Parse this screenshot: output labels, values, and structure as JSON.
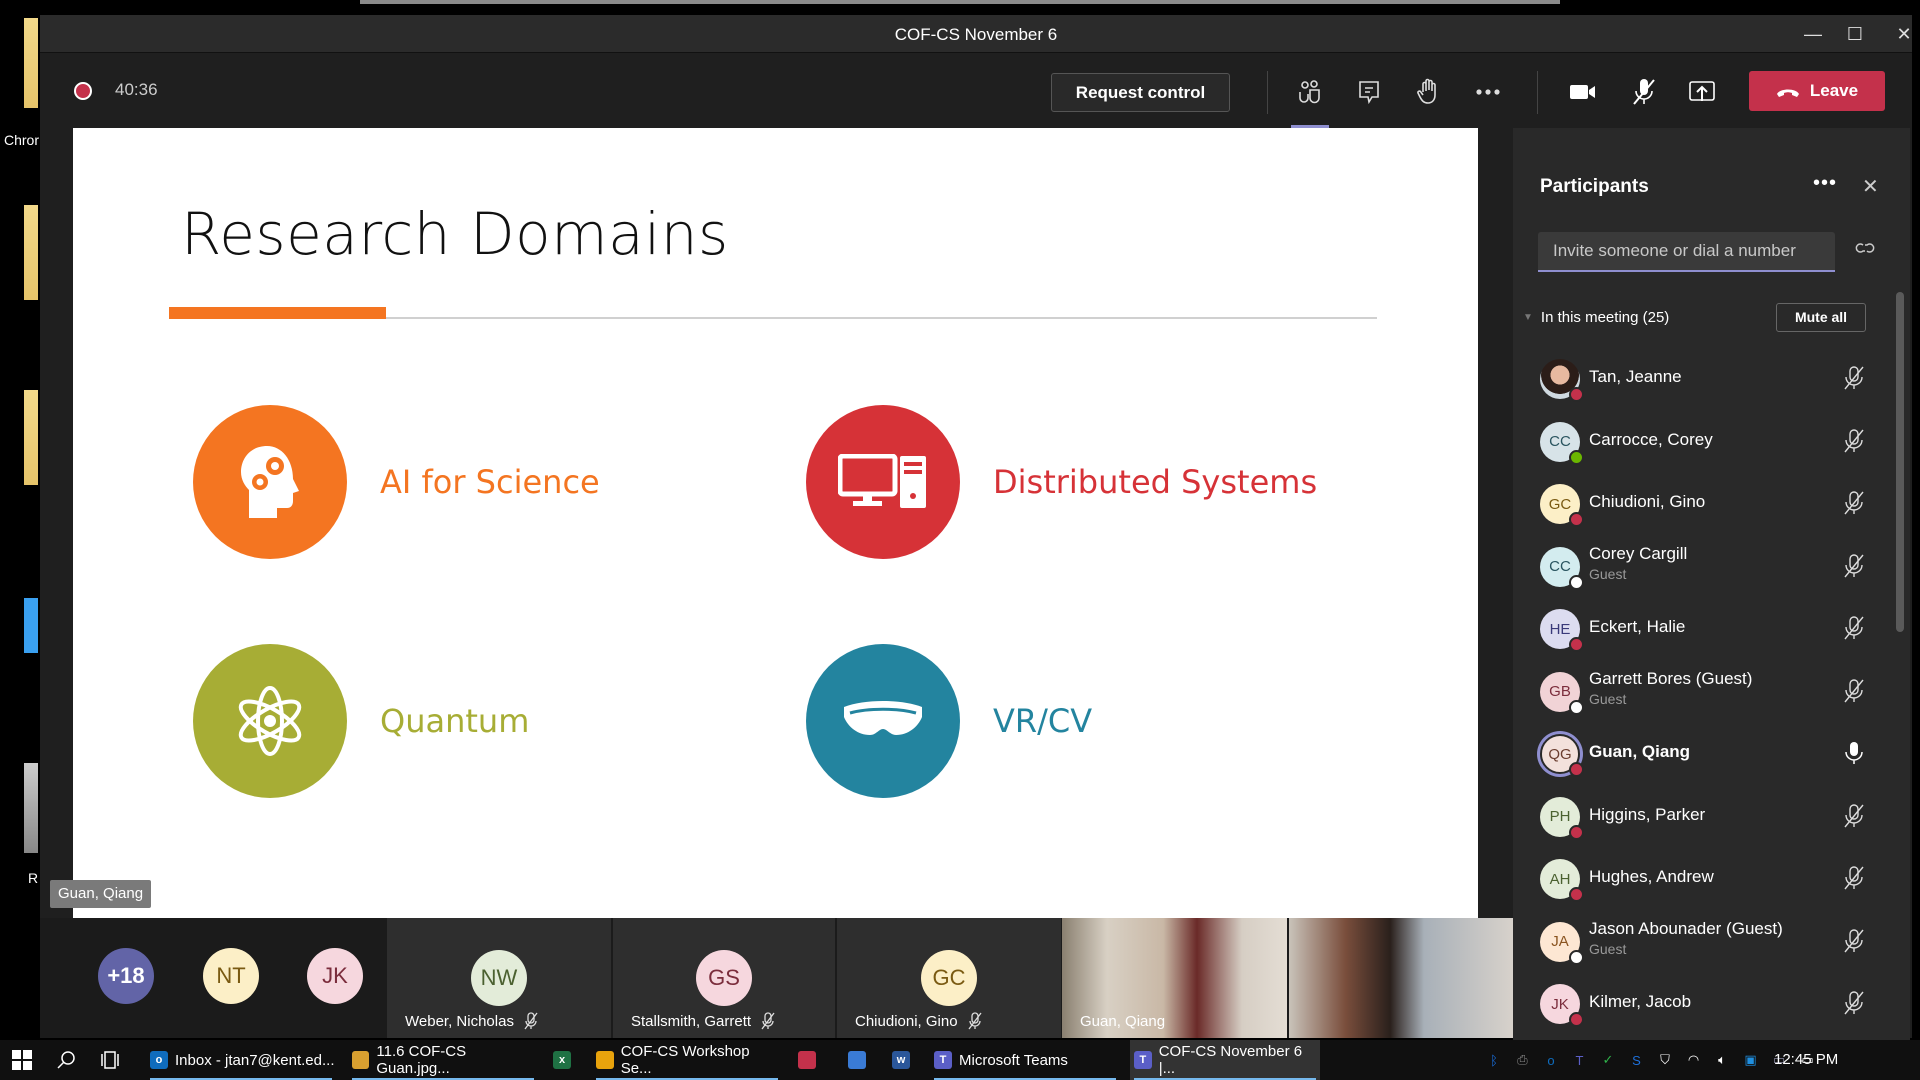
{
  "window": {
    "title": "COF-CS November 6",
    "minimize_label": "—",
    "maximize_label": "☐",
    "close_label": "✕"
  },
  "toolbar": {
    "timer": "40:36",
    "request_control": "Request control",
    "leave": "Leave",
    "icons": [
      "participants-icon",
      "chat-icon",
      "raise-hand-icon",
      "more-options-icon",
      "camera-icon",
      "mic-off-icon",
      "share-screen-icon"
    ]
  },
  "slide": {
    "title": "Research Domains",
    "accent_color": "#f47521",
    "domains": [
      {
        "label": "AI for Science",
        "color": "#f47521",
        "icon": "head-gears-icon"
      },
      {
        "label": "Distributed Systems",
        "color": "#d63237",
        "icon": "computer-icon"
      },
      {
        "label": "Quantum",
        "color": "#a7ad35",
        "icon": "atom-icon"
      },
      {
        "label": "VR/CV",
        "color": "#23849f",
        "icon": "vr-headset-icon"
      }
    ]
  },
  "presenter_tag": "Guan, Qiang",
  "desktop": {
    "labels": [
      "Chror",
      "R"
    ]
  },
  "video_strip": {
    "overflow": {
      "label": "+18",
      "bg": "#6264a7",
      "fg": "#ffffff"
    },
    "avatars": [
      {
        "initials": "NT",
        "bg": "#fcefc7",
        "fg": "#7a5a12"
      },
      {
        "initials": "JK",
        "bg": "#f6d7de",
        "fg": "#7b2d3c"
      }
    ],
    "tiles": [
      {
        "name": "Weber, Nicholas",
        "initials": "NW",
        "bg": "#e3ecd9",
        "fg": "#4b6130",
        "muted": true
      },
      {
        "name": "Stallsmith, Garrett",
        "initials": "GS",
        "bg": "#f6d7de",
        "fg": "#7b2d3c",
        "muted": true
      },
      {
        "name": "Chiudioni, Gino",
        "initials": "GC",
        "bg": "#fcefc7",
        "fg": "#7a5a12",
        "muted": true
      }
    ],
    "videos": [
      {
        "name": "Guan, Qiang"
      },
      {
        "name": ""
      }
    ]
  },
  "participants": {
    "title": "Participants",
    "more_label": "•••",
    "close_label": "✕",
    "invite_placeholder": "Invite someone or dial a number",
    "section_label": "In this meeting (25)",
    "mute_all": "Mute all",
    "people": [
      {
        "name": "Tan, Jeanne",
        "sub": "",
        "initials": "",
        "photo": true,
        "bg": "#cfd9e0",
        "fg": "#333",
        "status": "busy",
        "mic": "muted",
        "bold": false
      },
      {
        "name": "Carrocce, Corey",
        "sub": "",
        "initials": "CC",
        "photo": false,
        "bg": "#d7e3e8",
        "fg": "#2a5560",
        "status": "available",
        "mic": "muted",
        "bold": false
      },
      {
        "name": "Chiudioni, Gino",
        "sub": "",
        "initials": "GC",
        "photo": false,
        "bg": "#fcefc7",
        "fg": "#7a5a12",
        "status": "busy",
        "mic": "muted",
        "bold": false
      },
      {
        "name": "Corey Cargill",
        "sub": "Guest",
        "initials": "CC",
        "photo": false,
        "bg": "#d3ecef",
        "fg": "#2a5560",
        "status": "unknown",
        "mic": "muted",
        "bold": false
      },
      {
        "name": "Eckert, Halie",
        "sub": "",
        "initials": "HE",
        "photo": false,
        "bg": "#dcdcf0",
        "fg": "#3a3a7a",
        "status": "busy",
        "mic": "muted",
        "bold": false
      },
      {
        "name": "Garrett Bores (Guest)",
        "sub": "Guest",
        "initials": "GB",
        "photo": false,
        "bg": "#f1d3d6",
        "fg": "#7b2d3c",
        "status": "unknown",
        "mic": "muted",
        "bold": false
      },
      {
        "name": "Guan, Qiang",
        "sub": "",
        "initials": "QG",
        "photo": false,
        "bg": "#f3e1dc",
        "fg": "#6b3e30",
        "status": "dnd",
        "mic": "on",
        "bold": true,
        "active": true
      },
      {
        "name": "Higgins, Parker",
        "sub": "",
        "initials": "PH",
        "photo": false,
        "bg": "#e3ecd9",
        "fg": "#4b6130",
        "status": "busy",
        "mic": "muted",
        "bold": false
      },
      {
        "name": "Hughes, Andrew",
        "sub": "",
        "initials": "AH",
        "photo": false,
        "bg": "#e3ecd9",
        "fg": "#4b6130",
        "status": "busy",
        "mic": "muted",
        "bold": false
      },
      {
        "name": "Jason Abounader (Guest)",
        "sub": "Guest",
        "initials": "JA",
        "photo": false,
        "bg": "#fde7d3",
        "fg": "#8a5420",
        "status": "unknown",
        "mic": "muted",
        "bold": false
      },
      {
        "name": "Kilmer, Jacob",
        "sub": "",
        "initials": "JK",
        "photo": false,
        "bg": "#f6d7de",
        "fg": "#7b2d3c",
        "status": "busy",
        "mic": "muted",
        "bold": false
      }
    ],
    "status_colors": {
      "busy": "#c4314b",
      "available": "#6bb700",
      "unknown": "#ffffff",
      "dnd": "#c4314b"
    }
  },
  "taskbar": {
    "items": [
      {
        "label": "Inbox - jtan7@kent.ed...",
        "icon": "outlook-icon",
        "icon_color": "#0f6cbd",
        "icon_text": "o"
      },
      {
        "label": "11.6 COF-CS Guan.jpg...",
        "icon": "paint-icon",
        "icon_color": "#d9a030",
        "icon_text": ""
      },
      {
        "label": "",
        "icon": "excel-icon",
        "icon_color": "#1f7244",
        "icon_text": "x"
      },
      {
        "label": "COF-CS Workshop Se...",
        "icon": "chrome-icon",
        "icon_color": "#e8a30c",
        "icon_text": ""
      },
      {
        "label": "",
        "icon": "security-app-icon",
        "icon_color": "#c4314b",
        "icon_text": ""
      },
      {
        "label": "",
        "icon": "remote-desktop-icon",
        "icon_color": "#3a7bd5",
        "icon_text": ""
      },
      {
        "label": "",
        "icon": "word-icon",
        "icon_color": "#2b579a",
        "icon_text": "w"
      },
      {
        "label": "Microsoft Teams",
        "icon": "teams-icon",
        "icon_color": "#5b5fc7",
        "icon_text": "T"
      },
      {
        "label": "COF-CS November 6 |...",
        "icon": "teams-icon",
        "icon_color": "#5b5fc7",
        "icon_text": "T"
      }
    ],
    "tray": [
      "bluetooth-icon",
      "printer-icon",
      "outlook-tray-icon",
      "teams-tray-icon",
      "defender-check-icon",
      "sophos-icon",
      "shield-icon",
      "wifi-icon",
      "volume-icon",
      "network-app-icon",
      "display-icon",
      "battery-icon"
    ],
    "clock": "12:45 PM"
  }
}
